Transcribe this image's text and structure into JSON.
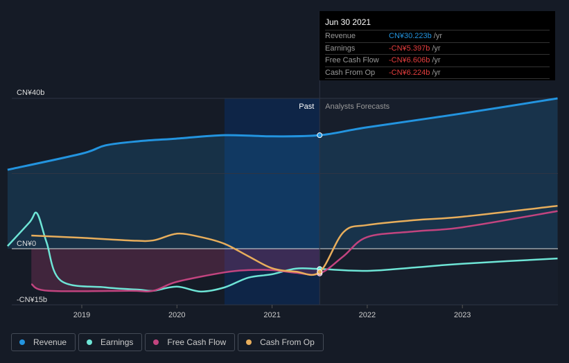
{
  "tooltip": {
    "date": "Jun 30 2021",
    "rows": [
      {
        "label": "Revenue",
        "value": "CN¥30.223b",
        "unit": "/yr"
      },
      {
        "label": "Earnings",
        "value": "-CN¥5.397b",
        "unit": "/yr"
      },
      {
        "label": "Free Cash Flow",
        "value": "-CN¥6.606b",
        "unit": "/yr"
      },
      {
        "label": "Cash From Op",
        "value": "-CN¥6.224b",
        "unit": "/yr"
      }
    ]
  },
  "legend": [
    {
      "label": "Revenue",
      "color": "#2394df"
    },
    {
      "label": "Earnings",
      "color": "#6ee5d6"
    },
    {
      "label": "Free Cash Flow",
      "color": "#c2447f"
    },
    {
      "label": "Cash From Op",
      "color": "#e8ae5c"
    }
  ],
  "chart_data": {
    "type": "line",
    "ylabels": [
      "CN¥40b",
      "CN¥0",
      "-CN¥15b"
    ],
    "ylim": [
      -15,
      40
    ],
    "xlim": [
      2018.0,
      2024.0
    ],
    "xticks": [
      "2019",
      "2020",
      "2021",
      "2022",
      "2023"
    ],
    "past_label": "Past",
    "forecast_label": "Analysts Forecasts",
    "divider_x": 2021.5,
    "series": [
      {
        "name": "Revenue",
        "color": "#2394df",
        "points": [
          [
            2018.22,
            21
          ],
          [
            2019,
            25.3
          ],
          [
            2019.25,
            27.5
          ],
          [
            2019.6,
            28.6
          ],
          [
            2020,
            29.3
          ],
          [
            2020.5,
            30.2
          ],
          [
            2021,
            29.9
          ],
          [
            2021.5,
            30.2
          ],
          [
            2022,
            32.3
          ],
          [
            2023,
            36
          ],
          [
            2024,
            40
          ]
        ]
      },
      {
        "name": "Earnings",
        "color": "#6ee5d6",
        "points": [
          [
            2018.22,
            0.7
          ],
          [
            2018.45,
            7
          ],
          [
            2018.53,
            9.4
          ],
          [
            2018.63,
            1.7
          ],
          [
            2018.78,
            -8.5
          ],
          [
            2019.25,
            -10.3
          ],
          [
            2019.6,
            -10.9
          ],
          [
            2019.75,
            -11.2
          ],
          [
            2020,
            -10.1
          ],
          [
            2020.25,
            -11.4
          ],
          [
            2020.5,
            -10.3
          ],
          [
            2020.75,
            -7.7
          ],
          [
            2021,
            -6.8
          ],
          [
            2021.25,
            -5.3
          ],
          [
            2021.5,
            -5.4
          ],
          [
            2022,
            -5.9
          ],
          [
            2022.5,
            -5
          ],
          [
            2023,
            -4
          ],
          [
            2024,
            -2.6
          ]
        ]
      },
      {
        "name": "Free Cash Flow",
        "color": "#c2447f",
        "points": [
          [
            2018.47,
            -9.4
          ],
          [
            2018.65,
            -11.2
          ],
          [
            2019.5,
            -11.2
          ],
          [
            2019.75,
            -11.2
          ],
          [
            2020,
            -8.8
          ],
          [
            2020.5,
            -6.3
          ],
          [
            2020.75,
            -5.7
          ],
          [
            2021,
            -5.7
          ],
          [
            2021.25,
            -6.4
          ],
          [
            2021.5,
            -6.6
          ],
          [
            2021.75,
            -2
          ],
          [
            2022,
            3.1
          ],
          [
            2022.5,
            4.6
          ],
          [
            2023,
            5.7
          ],
          [
            2024,
            10
          ]
        ]
      },
      {
        "name": "Cash From Op",
        "color": "#e8ae5c",
        "points": [
          [
            2018.47,
            3.5
          ],
          [
            2019,
            2.9
          ],
          [
            2019.5,
            2.2
          ],
          [
            2019.75,
            2.2
          ],
          [
            2020,
            4
          ],
          [
            2020.25,
            3.1
          ],
          [
            2020.5,
            1.3
          ],
          [
            2020.75,
            -2
          ],
          [
            2021,
            -5.2
          ],
          [
            2021.25,
            -6.1
          ],
          [
            2021.5,
            -6.2
          ],
          [
            2021.75,
            4.4
          ],
          [
            2022,
            6.3
          ],
          [
            2022.5,
            7.6
          ],
          [
            2023,
            8.5
          ],
          [
            2024,
            11.4
          ]
        ]
      }
    ]
  }
}
